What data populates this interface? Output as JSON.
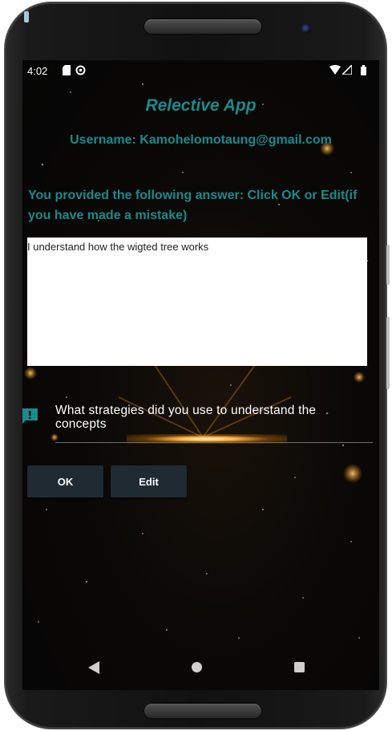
{
  "status_bar": {
    "time": "4:02",
    "left_icons": [
      "sd-card-icon",
      "sync-icon"
    ],
    "right_icons": [
      "wifi-icon",
      "signal-icon",
      "battery-icon"
    ]
  },
  "app": {
    "title": "Relective App",
    "username_line": "Username: Kamohelomotaung@gmail.com",
    "instruction": "You provided the following answer: Click OK or Edit(if you have made a mistake)",
    "answer_text": "I understand how the wigted tree works",
    "question": "What strategies did you use to understand the concepts",
    "question_icon": "comment-alert-icon",
    "buttons": {
      "ok": "OK",
      "edit": "Edit"
    }
  },
  "colors": {
    "accent": "#1b8a8c",
    "button_bg": "#1f2a33",
    "screen_bg": "#0b0907"
  },
  "nav_bar": {
    "icons": [
      "back-icon",
      "home-icon",
      "recents-icon"
    ]
  }
}
